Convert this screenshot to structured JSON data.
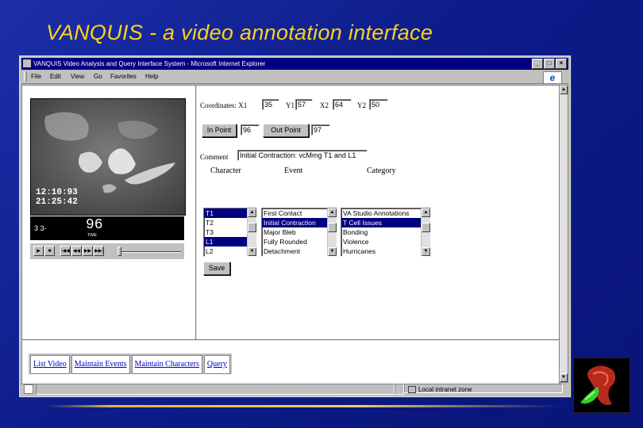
{
  "slide": {
    "title": "VANQUIS  - a video annotation interface"
  },
  "window": {
    "title": "VANQUIS   Video Analysis and  Query Interface System - Microsoft Internet Explorer",
    "buttons": {
      "minimize": "_",
      "maximize": "□",
      "close": "×"
    }
  },
  "menu": {
    "file": "File",
    "edit": "Edit",
    "view": "View",
    "go": "Go",
    "favorites": "Favorites",
    "help": "Help"
  },
  "video": {
    "timestamp_line1": "12:10:93",
    "timestamp_line2": "21:25:42",
    "counter_left": "3 3-",
    "counter_value": "96",
    "counter_unit": "TIME",
    "transport": {
      "play": "▶",
      "stop": "■",
      "first": "|◀◀",
      "rewind": "◀◀",
      "forward": "▶▶",
      "last": "▶▶|"
    }
  },
  "form": {
    "coordinates_label": "Coordinates: X1",
    "x1": "35",
    "y1_label": "Y1",
    "y1": "57",
    "x2_label": "X2",
    "x2": "64",
    "y2_label": "Y2",
    "y2": "50",
    "in_point_button": "In Point",
    "in_point_value": "96",
    "out_point_button": "Out Point",
    "out_point_value": "97",
    "comment_label": "Comment",
    "comment_value": "Initial Contraction: vcMmg T1 and L1",
    "character_header": "Character",
    "event_header": "Event",
    "category_header": "Category",
    "characters": [
      {
        "label": "T1",
        "selected": true
      },
      {
        "label": "T2",
        "selected": false
      },
      {
        "label": "T3",
        "selected": false
      },
      {
        "label": "L1",
        "selected": true
      },
      {
        "label": "L2",
        "selected": false
      }
    ],
    "events": [
      {
        "label": "First Contact",
        "selected": false
      },
      {
        "label": "Initial Contraction",
        "selected": true
      },
      {
        "label": "Major Bleb",
        "selected": false
      },
      {
        "label": "Fully Rounded",
        "selected": false
      },
      {
        "label": "Detachment",
        "selected": false
      }
    ],
    "categories": [
      {
        "label": "VA Studio Annotations",
        "selected": false
      },
      {
        "label": "T Cell Issues",
        "selected": true
      },
      {
        "label": "Bonding",
        "selected": false
      },
      {
        "label": "Violence",
        "selected": false
      },
      {
        "label": "Hurricanes",
        "selected": false
      }
    ],
    "save_button": "Save"
  },
  "nav": {
    "list_video": "List Video",
    "maintain_events": "Maintain Events",
    "maintain_characters": "Maintain Characters",
    "query": "Query"
  },
  "status": {
    "zone": "Local intranet zone"
  }
}
